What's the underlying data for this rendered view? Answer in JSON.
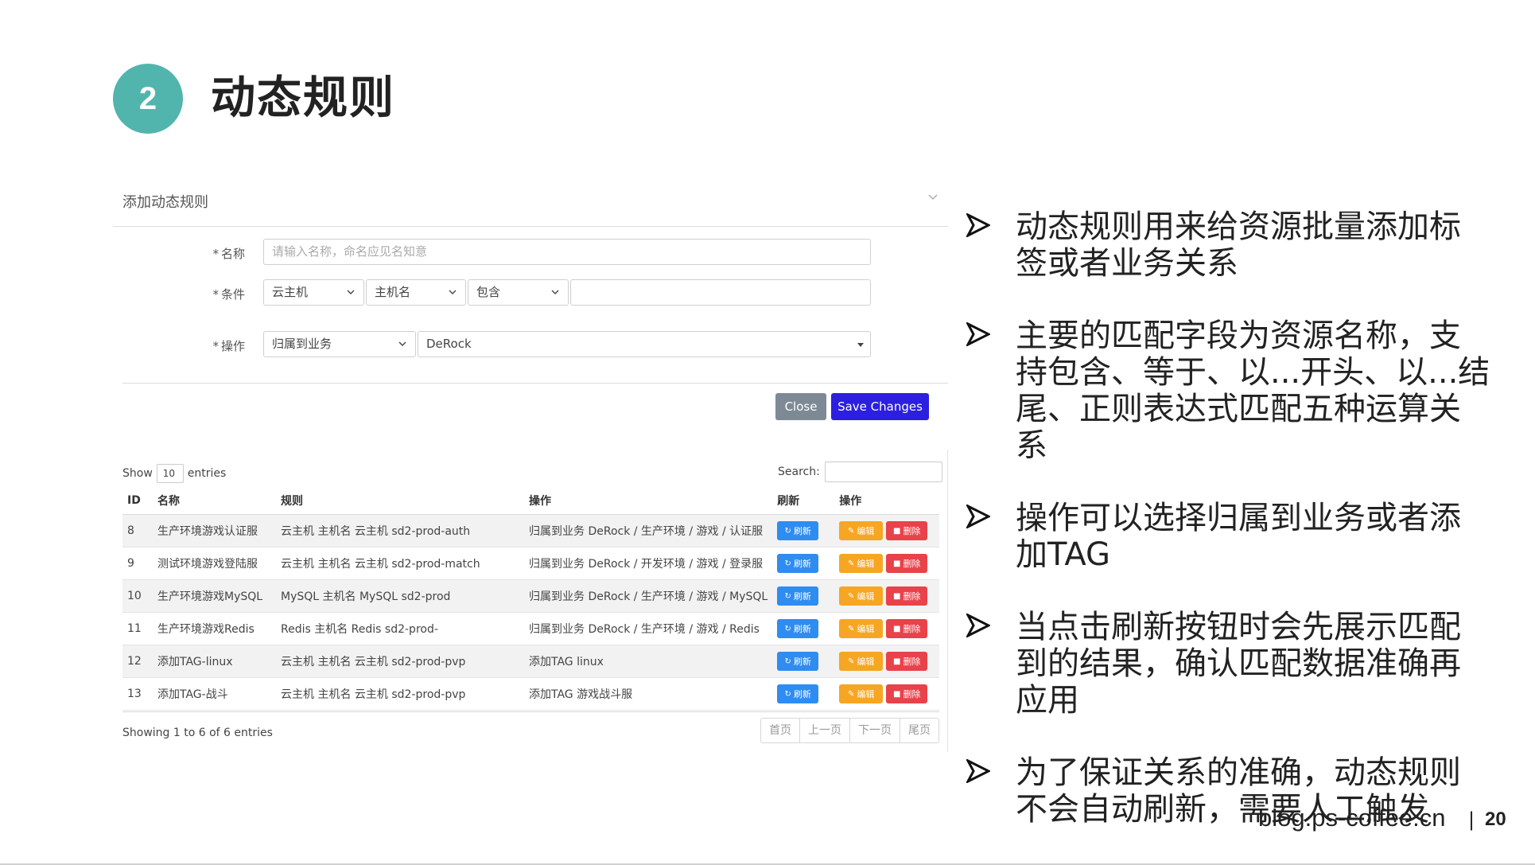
{
  "slide": {
    "number": "2",
    "title": "动态规则",
    "site": "blog.ps-coffee.cn",
    "separator": "|",
    "page": "20"
  },
  "panel": {
    "title": "添加动态规则",
    "name_label": "名称",
    "name_placeholder": "请输入名称，命名应见名知意",
    "condition_label": "条件",
    "condition": {
      "resource": "云主机",
      "field": "主机名",
      "operator": "包含",
      "value": ""
    },
    "action_label": "操作",
    "action": {
      "type": "归属到业务",
      "target": "DeRock"
    },
    "close_label": "Close",
    "save_label": "Save Changes"
  },
  "table": {
    "show_prefix": "Show",
    "show_value": "10",
    "show_suffix": "entries",
    "search_label": "Search:",
    "headers": [
      "ID",
      "名称",
      "规则",
      "操作",
      "刷新",
      "操作"
    ],
    "rows": [
      {
        "id": "8",
        "name": "生产环境游戏认证服",
        "rule": "云主机 主机名 云主机 sd2-prod-auth",
        "action": "归属到业务 DeRock / 生产环境 / 游戏 / 认证服"
      },
      {
        "id": "9",
        "name": "测试环境游戏登陆服",
        "rule": "云主机 主机名 云主机 sd2-prod-match",
        "action": "归属到业务 DeRock / 开发环境 / 游戏 / 登录服"
      },
      {
        "id": "10",
        "name": "生产环境游戏MySQL",
        "rule": "MySQL 主机名 MySQL sd2-prod",
        "action": "归属到业务 DeRock / 生产环境 / 游戏 / MySQL"
      },
      {
        "id": "11",
        "name": "生产环境游戏Redis",
        "rule": "Redis 主机名 Redis sd2-prod-",
        "action": "归属到业务 DeRock / 生产环境 / 游戏 / Redis"
      },
      {
        "id": "12",
        "name": "添加TAG-linux",
        "rule": "云主机 主机名 云主机 sd2-prod-pvp",
        "action": "添加TAG linux"
      },
      {
        "id": "13",
        "name": "添加TAG-战斗",
        "rule": "云主机 主机名 云主机 sd2-prod-pvp",
        "action": "添加TAG 游戏战斗服"
      }
    ],
    "refresh_label": "刷新",
    "edit_label": "编辑",
    "delete_label": "删除",
    "showing": "Showing 1 to 6 of 6 entries",
    "pager": [
      "首页",
      "上一页",
      "下一页",
      "尾页"
    ]
  },
  "bullets": [
    "动态规则用来给资源批量添加标签或者业务关系",
    "主要的匹配字段为资源名称，支持包含、等于、以...开头、以...结尾、正则表达式匹配五种运算关系",
    "操作可以选择归属到业务或者添加TAG",
    "当点击刷新按钮时会先展示匹配到的结果，确认匹配数据准确再应用",
    "为了保证关系的准确，动态规则不会自动刷新，需要人工触发"
  ],
  "colors": {
    "badge": "#52b5ad",
    "save": "#2c1fe0",
    "refresh": "#2f8cf0",
    "edit": "#f6a623",
    "delete": "#e8424a"
  }
}
